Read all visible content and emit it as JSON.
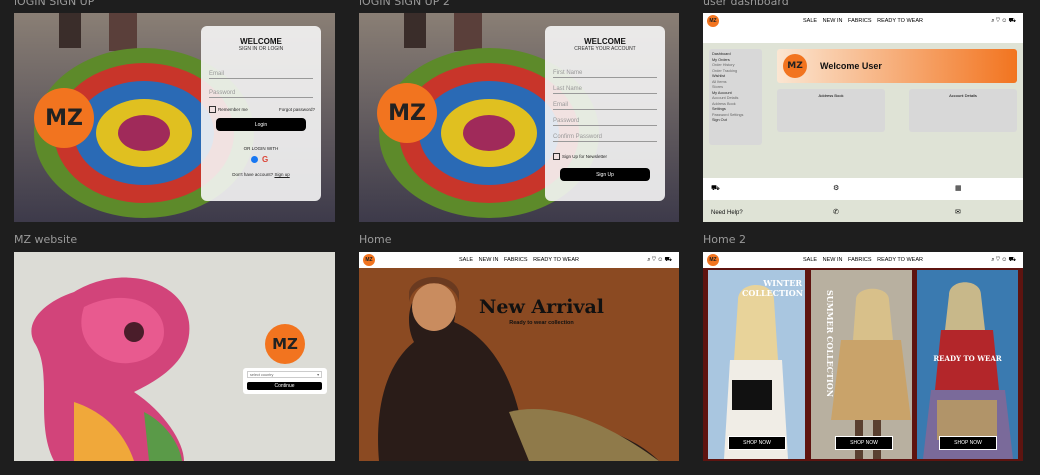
{
  "frames": {
    "login": {
      "label": "lOGIN SIGN UP",
      "card": {
        "title": "WELCOME",
        "subtitle": "SIGN IN OR LOGIN",
        "email_placeholder": "Email",
        "password_placeholder": "Password",
        "remember": "Remember me",
        "forgot": "Forgot password?",
        "login_button": "Login",
        "or_login": "OR LOGIN WITH",
        "no_account": "Don't have account?",
        "signup_link": "Sign up"
      }
    },
    "signup": {
      "label": "lOGIN SIGN UP 2",
      "card": {
        "title": "WELCOME",
        "subtitle": "CREATE YOUR ACCOUNT",
        "first_name": "First Name",
        "last_name": "Last Name",
        "email": "Email",
        "password": "Password",
        "confirm": "Confirm Password",
        "newsletter": "Sign Up for Newsletter",
        "button": "Sign Up"
      }
    },
    "dashboard": {
      "label": "user dashboard",
      "sidebar": [
        "Dashboard",
        "My Orders",
        "Order History",
        "Order Tracking",
        "Wishlist",
        "All Items",
        "Stores",
        "My Account",
        "Account Details",
        "Address Book",
        "Settings",
        "Password Settings",
        "Sign Out"
      ],
      "welcome": "Welcome User",
      "address_book": "Address Book",
      "account_details": "Account Details",
      "need_help": "Need Help?"
    },
    "mz": {
      "label": "MZ website",
      "select_value": "select country",
      "continue": "Continue"
    },
    "home": {
      "label": "Home",
      "headline": "New Arrival",
      "tagline": "Ready to wear collection"
    },
    "home2": {
      "label": "Home 2",
      "winter": "WINTER COLLECTION",
      "summer": "SUMMER COLLECTION",
      "ready": "READY TO WEAR",
      "shop_now": "SHOP NOW"
    }
  },
  "nav": {
    "items": [
      "SALE",
      "NEW IN",
      "FABRICS",
      "READY TO WEAR"
    ],
    "icons": [
      "search-icon",
      "heart-icon",
      "user-icon",
      "cart-icon"
    ]
  },
  "logo_text": "MZ",
  "colors": {
    "accent": "#f2741f",
    "canvas": "#1e1e1e",
    "dashboard_bg": "#dfe3d6"
  }
}
